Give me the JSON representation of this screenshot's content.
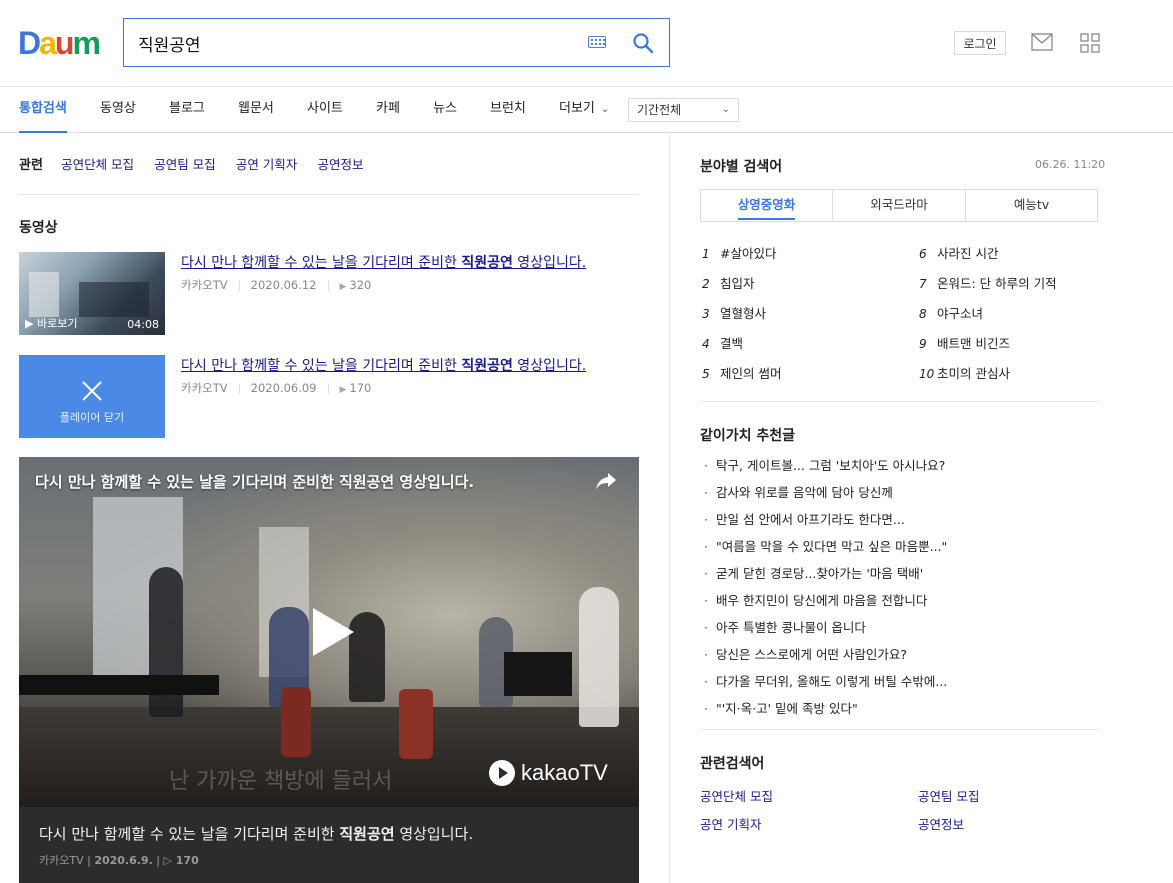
{
  "header": {
    "logo": [
      "D",
      "a",
      "u",
      "m"
    ],
    "logo_colors": [
      "#3c78dc",
      "#f4b400",
      "#db4437",
      "#0f9d58"
    ],
    "search_value": "직원공연",
    "login_label": "로그인"
  },
  "tabs": [
    {
      "label": "통합검색",
      "active": true
    },
    {
      "label": "동영상"
    },
    {
      "label": "블로그"
    },
    {
      "label": "웹문서"
    },
    {
      "label": "사이트"
    },
    {
      "label": "카페"
    },
    {
      "label": "뉴스"
    },
    {
      "label": "브런치"
    },
    {
      "label": "더보기"
    }
  ],
  "period_select": "기간전체",
  "related": {
    "label": "관련",
    "links": [
      "공연단체 모집",
      "공연팀 모집",
      "공연 기획자",
      "공연정보"
    ]
  },
  "video_section": {
    "title": "동영상",
    "items": [
      {
        "title_pre": "다시 만나 함께할 수 있는 날을 기다리며 준비한 ",
        "title_bold": "직원공연",
        "title_post": " 영상입니다.",
        "source": "카카오TV",
        "date": "2020.06.12",
        "views": "320",
        "thumb_play": "▶ 바로보기",
        "thumb_duration": "04:08"
      },
      {
        "title_pre": "다시 만나 함께할 수 있는 날을 기다리며 준비한 ",
        "title_bold": "직원공연",
        "title_post": " 영상입니다.",
        "source": "카카오TV",
        "date": "2020.06.09",
        "views": "170",
        "thumb_close": "플레이어 닫기"
      }
    ],
    "player": {
      "overlay_title": "다시 만나 함께할 수 있는 날을 기다리며 준비한 직원공연 영상입니다.",
      "burned_subtitle": "난 가까운 책방에 들러서",
      "brand": "kakaoTV",
      "caption_pre": "다시 만나 함께할 수 있는 날을 기다리며 준비한 ",
      "caption_bold": "직원공연",
      "caption_post": " 영상입니다.",
      "meta_source": "카카오TV",
      "meta_date": "2020.6.9.",
      "meta_views": "▷ 170"
    }
  },
  "rankings": {
    "title": "분야별 검색어",
    "time": "06.26. 11:20",
    "tabs": [
      "상영중영화",
      "외국드라마",
      "예능tv"
    ],
    "items": [
      {
        "num": "1",
        "label": "#살아있다"
      },
      {
        "num": "2",
        "label": "침입자"
      },
      {
        "num": "3",
        "label": "열혈형사"
      },
      {
        "num": "4",
        "label": "결백"
      },
      {
        "num": "5",
        "label": "제인의 썸머"
      },
      {
        "num": "6",
        "label": "사라진 시간"
      },
      {
        "num": "7",
        "label": "온워드: 단 하루의 기적"
      },
      {
        "num": "8",
        "label": "야구소녀"
      },
      {
        "num": "9",
        "label": "배트맨 비긴즈"
      },
      {
        "num": "10",
        "label": "초미의 관심사"
      }
    ]
  },
  "recommend": {
    "title": "같이가치 추천글",
    "items": [
      "탁구, 게이트볼... 그럼 '보치아'도 아시나요?",
      "감사와 위로를 음악에 담아 당신께",
      "만일 섬 안에서 아프기라도 한다면...",
      "\"여름을 막을 수 있다면 막고 싶은 마음뿐...\"",
      "굳게 닫힌 경로당...찾아가는 '마음 택배'",
      "배우 한지민이 당신에게 마음을 전합니다",
      "아주 특별한 콩나물이 옵니다",
      "당신은 스스로에게 어떤 사람인가요?",
      "다가올 무더위, 올해도 이렇게 버틸 수밖에...",
      "\"'지·옥·고' 밑에 족방 있다\""
    ]
  },
  "related_searches": {
    "title": "관련검색어",
    "links": [
      "공연단체 모집",
      "공연팀 모집",
      "공연 기획자",
      "공연정보"
    ]
  }
}
